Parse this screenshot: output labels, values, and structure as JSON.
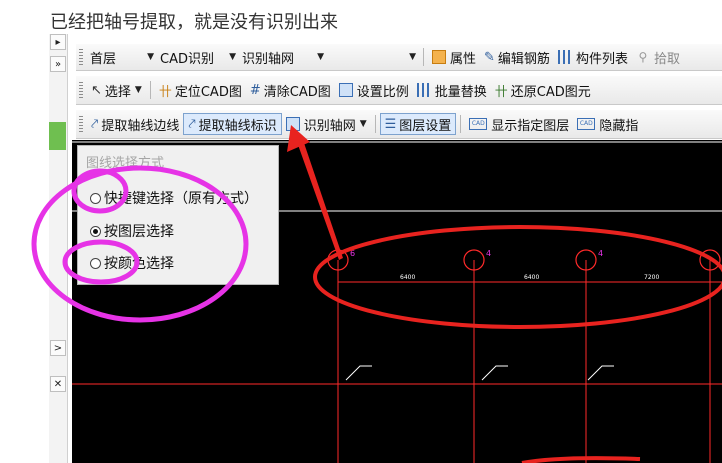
{
  "caption": "已经把轴号提取，就是没有识别出来",
  "left_panel": {
    "btn_top": "▸",
    "btn_expand": "»",
    "btn_side": ">",
    "btn_close": "✕"
  },
  "toolbar1": {
    "floor": "首层",
    "cad_recognize": "CAD识别",
    "recognize_axis_grid": "识别轴网",
    "empty_combo": "",
    "properties": "属性",
    "edit_rebar": "编辑钢筋",
    "component_list": "构件列表",
    "pick": "拾取"
  },
  "toolbar2": {
    "select": "选择",
    "locate_cad": "定位CAD图",
    "clear_cad": "清除CAD图",
    "set_scale": "设置比例",
    "batch_replace": "批量替换",
    "restore_cad": "还原CAD图元"
  },
  "toolbar3": {
    "extract_axis_edge": "提取轴线边线",
    "extract_axis_label": "提取轴线标识",
    "recognize_axis": "识别轴网",
    "layer_settings": "图层设置",
    "show_layer": "显示指定图层",
    "hide": "隐藏指"
  },
  "popup": {
    "title": "图线选择方式",
    "options": [
      {
        "label": "快捷键选择（原有方式）",
        "selected": false
      },
      {
        "label": "按图层选择",
        "selected": true
      },
      {
        "label": "按颜色选择",
        "selected": false
      }
    ]
  },
  "drawing": {
    "dimension_labels": [
      "6400",
      "6400",
      "7200"
    ],
    "axis_markers": [
      "6",
      "4",
      "4"
    ]
  },
  "colors": {
    "annotation_magenta": "#e633e6",
    "annotation_red": "#e8231f",
    "cad_red": "#ff2a2a",
    "cad_background": "#000000"
  }
}
